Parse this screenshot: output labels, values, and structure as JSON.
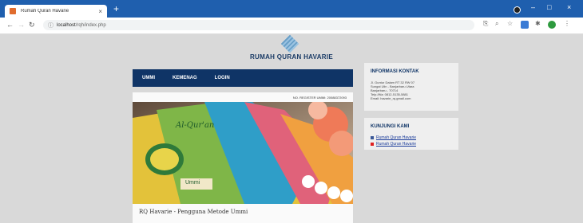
{
  "browser": {
    "tab_title": "Rumah Quran Havarie",
    "tab_close": "×",
    "new_tab": "+",
    "url_host": "localhost",
    "url_path": "/rqh/index.php",
    "win_minimize": "–",
    "win_maximize": "□",
    "win_close": "×"
  },
  "site": {
    "title": "RUMAH QURAN HAVARIE",
    "nav": [
      "UMMI",
      "KEMENAG",
      "LOGIN"
    ]
  },
  "post": {
    "reg_no": "NO. REGISTER UMMI: 20088372093",
    "photo_text": "Al-Qur'an",
    "photo_text2": "Ummi",
    "caption": "RQ Havarie - Pengguna Metode Ummi"
  },
  "sidebar": {
    "contact_title": "INFORMASI KONTAK",
    "contact_text": "Jl. Guntur Dalam RT 32 RW 07\nSungai Ulin - Banjarbaru Utara\nBanjarbaru - 70714\nTelp./Wa: 0812-5135-5881\nEmail: havarie_rq.gmail.com",
    "visit_title": "KUNJUNGI KAMI",
    "links": [
      {
        "label": "Rumah Quran Havarie",
        "color": "#3b5998"
      },
      {
        "label": "Rumah Quran Havarie",
        "color": "#e02020"
      }
    ]
  }
}
